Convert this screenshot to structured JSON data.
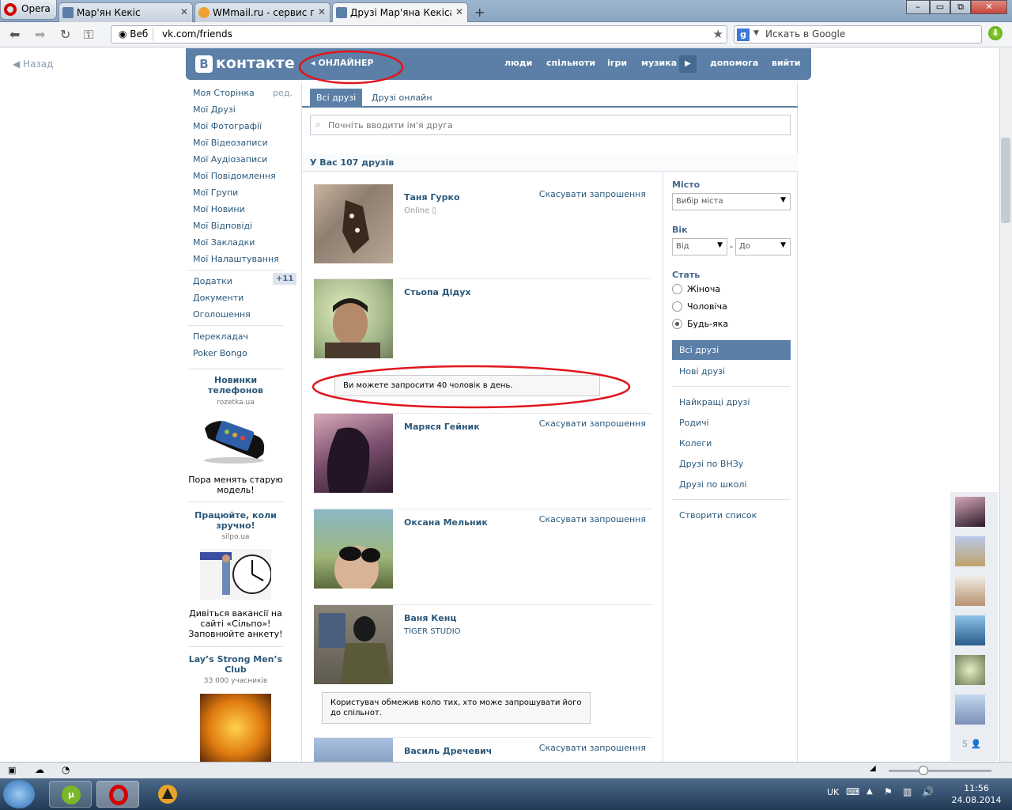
{
  "browser": {
    "opera_label": "Opera",
    "tabs": [
      {
        "label": "Мар'ян Кекіс"
      },
      {
        "label": "WMmail.ru - сервис п..."
      },
      {
        "label": "Друзі Мар'яна Кекіса |..."
      }
    ],
    "web_label": "Веб",
    "url": "vk.com/friends",
    "search_placeholder": "Искать в Google"
  },
  "page": {
    "back_label": "Назад",
    "logo": "контакте",
    "logo_badge": "В",
    "onliner": "ОНЛАЙНЕР",
    "top_nav": [
      "люди",
      "спільноти",
      "ігри",
      "музика",
      "допомога",
      "вийти"
    ],
    "left_menu": [
      "Моя Сторінка",
      "Мої Друзі",
      "Мої Фотографії",
      "Мої Відеозаписи",
      "Мої Аудіозаписи",
      "Мої Повідомлення",
      "Мої Групи",
      "Мої Новини",
      "Мої Відповіді",
      "Мої Закладки",
      "Мої Налаштування"
    ],
    "edit_label": "ред.",
    "left_menu2": [
      "Додатки",
      "Документи",
      "Оголошення"
    ],
    "apps_badge": "+11",
    "left_menu3": [
      "Перекладач",
      "Poker Bongo"
    ],
    "ads": [
      {
        "title": "Новинки телефонов",
        "sub": "rozetka.ua",
        "text": "Пора менять старую модель!"
      },
      {
        "title": "Працюйте, коли зручно!",
        "sub": "silpo.ua",
        "text": "Дивіться вакансії на сайті «Сільпо»! Заповнюйте анкету!"
      },
      {
        "title": "Lay’s Strong Men’s Club",
        "sub": "33 000 учасників"
      }
    ],
    "tab_all": "Всі друзі",
    "tab_online": "Друзі онлайн",
    "search_placeholder": "Почніть вводити ім'я друга",
    "count_text": "У Вас 107 друзів",
    "friends": [
      {
        "name": "Таня Гурко",
        "sub": "Online",
        "action": "Скасувати запрошення"
      },
      {
        "name": "Стьопа Дідух",
        "sub": "",
        "action": ""
      },
      {
        "name": "Маряся Гейник",
        "sub": "",
        "action": "Скасувати запрошення"
      },
      {
        "name": "Оксана Мельник",
        "sub": "",
        "action": "Скасувати запрошення"
      },
      {
        "name": "Ваня Кенц",
        "sub": "TIGER STUDIO",
        "action": ""
      },
      {
        "name": "Василь Дречевич",
        "sub": "",
        "action": "Скасувати запрошення"
      }
    ],
    "notice_limit": "Ви можете запросити 40 чоловік в день.",
    "notice_restricted": "Користувач обмежив коло тих, хто може запрошувати його до спільнот.",
    "filter": {
      "city_label": "Місто",
      "city_value": "Вибір міста",
      "age_label": "Вік",
      "age_from": "Від",
      "age_to": "До",
      "age_dash": "-",
      "sex_label": "Стать",
      "sex_options": [
        "Жіноча",
        "Чоловіча",
        "Будь-яка"
      ],
      "sex_selected": 2,
      "lists": [
        "Всі друзі",
        "Нові друзі"
      ],
      "lists2": [
        "Найкращі друзі",
        "Родичі",
        "Колеги",
        "Друзі по ВНЗу",
        "Друзі по школі"
      ],
      "create_list": "Створити список"
    },
    "strip_count": "5"
  },
  "taskbar": {
    "lang": "UK",
    "time": "11:56",
    "date": "24.08.2014"
  },
  "colors": {
    "vk_blue": "#5b7fa6",
    "link": "#2b587a",
    "annotation_red": "#e0161e"
  }
}
